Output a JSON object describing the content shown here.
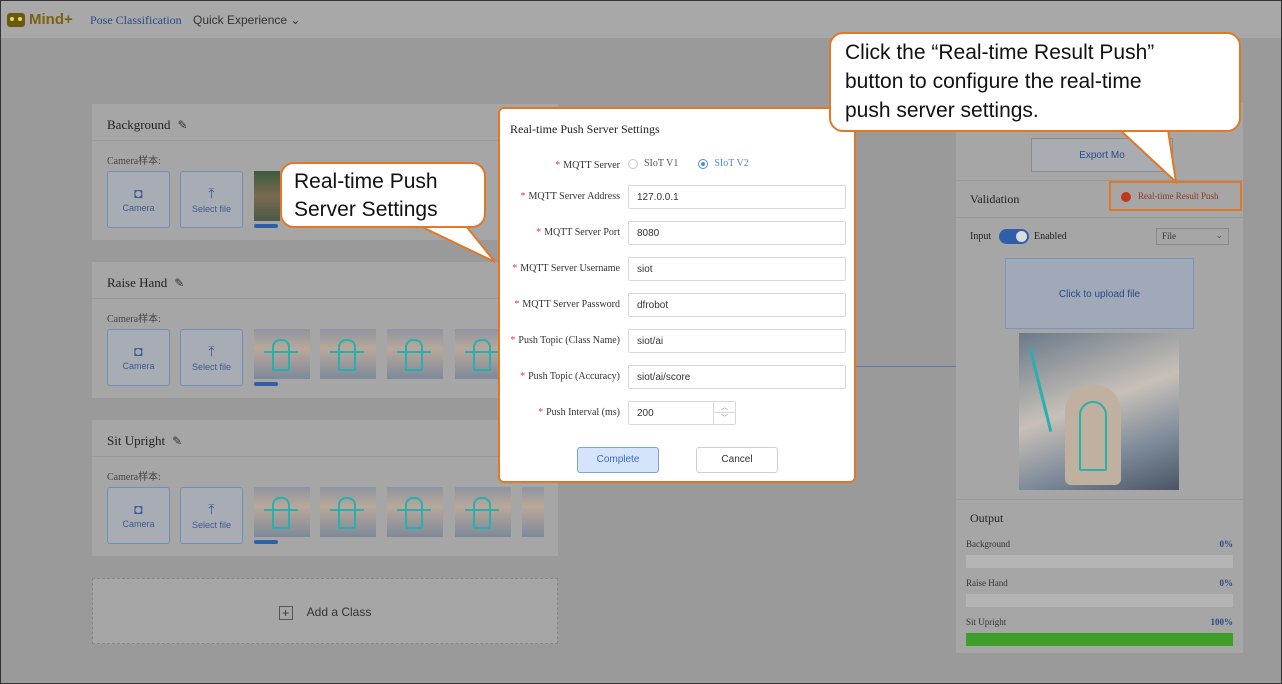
{
  "app": {
    "logo_text": "Mind+",
    "nav_pose": "Pose Classification",
    "nav_quick": "Quick Experience",
    "nav_quick_chevron": "⌄"
  },
  "classes": [
    {
      "name": "Background",
      "camera_label": "Camera样本:",
      "camera_btn": "Camera",
      "select_btn": "Select file"
    },
    {
      "name": "Raise Hand",
      "camera_label": "Camera样本:",
      "camera_btn": "Camera",
      "select_btn": "Select file"
    },
    {
      "name": "Sit Upright",
      "camera_label": "Camera样本:",
      "camera_btn": "Camera",
      "select_btn": "Select file"
    }
  ],
  "add_class": "Add a Class",
  "right_panel": {
    "export_button": "Export Mo",
    "validation_title": "Validation",
    "realtime_push_button": "Real-time Result Push",
    "input_label": "Input",
    "enabled_label": "Enabled",
    "input_source": "File",
    "upload_text": "Click to upload file",
    "output_title": "Output",
    "outputs": [
      {
        "name": "Background",
        "value": "0%",
        "fraction": 0
      },
      {
        "name": "Raise Hand",
        "value": "0%",
        "fraction": 0
      },
      {
        "name": "Sit Upright",
        "value": "100%",
        "fraction": 1
      }
    ]
  },
  "modal": {
    "title": "Real-time Push Server Settings",
    "mqtt_server_label": "MQTT Server",
    "mqtt_options": [
      "SIoT V1",
      "SIoT V2"
    ],
    "mqtt_selected": "SIoT V2",
    "fields": [
      {
        "label": "MQTT Server Address",
        "value": "127.0.0.1"
      },
      {
        "label": "MQTT Server Port",
        "value": "8080"
      },
      {
        "label": "MQTT Server Username",
        "value": "siot"
      },
      {
        "label": "MQTT Server Password",
        "value": "dfrobot"
      },
      {
        "label": "Push Topic (Class Name)",
        "value": "siot/ai"
      },
      {
        "label": "Push Topic (Accuracy)",
        "value": "siot/ai/score"
      }
    ],
    "interval_label": "Push Interval (ms)",
    "interval_value": "200",
    "required_mark": "*",
    "complete_button": "Complete",
    "cancel_button": "Cancel"
  },
  "callouts": {
    "top_right_lines": [
      "Click the “Real-time Result Push”",
      "button to configure the real-time",
      "push server settings."
    ],
    "left_lines": [
      "Real-time Push",
      "Server Settings"
    ]
  },
  "colors": {
    "accent_orange": "#e07828",
    "primary_blue": "#4a8ae8",
    "success_green": "#3f9e2a",
    "status_red": "#c0391b"
  }
}
